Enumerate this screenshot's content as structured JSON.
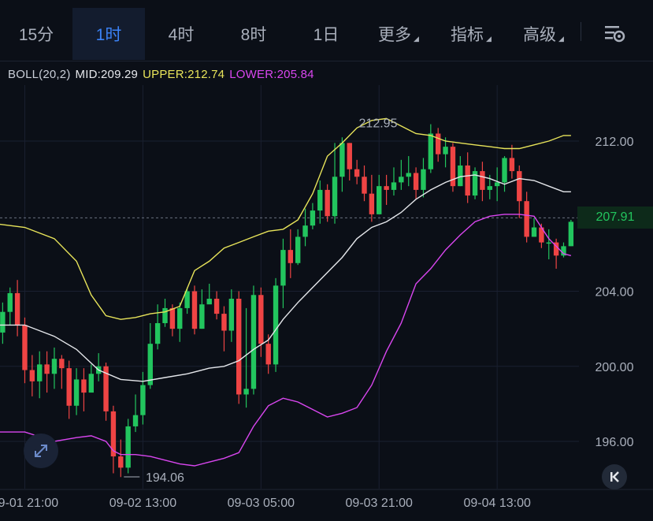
{
  "tabs": [
    {
      "label": "15分",
      "dropdown": false,
      "active": false
    },
    {
      "label": "1时",
      "dropdown": false,
      "active": true
    },
    {
      "label": "4时",
      "dropdown": false,
      "active": false
    },
    {
      "label": "8时",
      "dropdown": false,
      "active": false
    },
    {
      "label": "1日",
      "dropdown": false,
      "active": false
    },
    {
      "label": "更多",
      "dropdown": true,
      "active": false
    },
    {
      "label": "指标",
      "dropdown": true,
      "active": false
    },
    {
      "label": "高级",
      "dropdown": true,
      "active": false
    }
  ],
  "indicator": {
    "name": "BOLL(20,2)",
    "mid": "MID:209.29",
    "upper": "UPPER:212.74",
    "lower": "LOWER:205.84"
  },
  "current_price": "207.91",
  "colors": {
    "up": "#22c55e",
    "down": "#ef4444",
    "mid": "#e5e7eb",
    "upper": "#e8e45a",
    "lower": "#d946ef",
    "active_tab": "#3b82f6"
  },
  "icons": {
    "settings": "chart-settings-icon",
    "zoom": "expand-arrows-icon",
    "scroll": "jump-to-latest-icon"
  },
  "chart_data": {
    "type": "candlestick",
    "y_ticks": [
      "212.00",
      "204.00",
      "200.00",
      "196.00"
    ],
    "y_tick_values": [
      212,
      204,
      200,
      196
    ],
    "x_ticks": [
      "09-01 21:00",
      "09-02 13:00",
      "09-03 05:00",
      "09-03 21:00",
      "09-04 13:00"
    ],
    "x_tick_index": [
      4,
      20,
      36,
      52,
      68
    ],
    "annotations": [
      {
        "label": "212.95",
        "value": 212.95,
        "type": "high"
      },
      {
        "label": "194.06",
        "value": 194.06,
        "type": "low"
      }
    ],
    "current_value": 207.91,
    "y_range": [
      194.0,
      213.3
    ],
    "candles": [
      [
        204.6,
        203.2,
        204.0,
        201.8
      ],
      [
        201.8,
        202.9,
        203.4,
        201.2
      ],
      [
        202.9,
        203.9,
        204.2,
        202.2
      ],
      [
        203.9,
        202.2,
        204.6,
        201.6
      ],
      [
        202.2,
        199.8,
        202.6,
        199.1
      ],
      [
        199.8,
        199.2,
        200.6,
        198.4
      ],
      [
        199.2,
        200.1,
        200.8,
        198.3
      ],
      [
        200.1,
        199.6,
        200.8,
        198.6
      ],
      [
        199.6,
        200.4,
        201.0,
        198.8
      ],
      [
        200.4,
        199.9,
        200.6,
        198.8
      ],
      [
        199.9,
        197.9,
        200.3,
        197.2
      ],
      [
        197.9,
        199.3,
        199.9,
        197.4
      ],
      [
        199.3,
        198.6,
        199.9,
        197.6
      ],
      [
        198.6,
        199.6,
        200.1,
        198.9
      ],
      [
        199.6,
        200.0,
        200.7,
        199.2
      ],
      [
        200.0,
        197.6,
        200.2,
        197.1
      ],
      [
        197.6,
        195.2,
        197.9,
        194.3
      ],
      [
        195.2,
        194.6,
        196.1,
        194.1
      ],
      [
        194.6,
        196.8,
        197.2,
        194.3
      ],
      [
        196.8,
        197.4,
        198.5,
        196.5
      ],
      [
        197.4,
        199.0,
        199.7,
        196.9
      ],
      [
        199.0,
        201.2,
        202.3,
        198.8
      ],
      [
        201.2,
        202.3,
        203.3,
        200.9
      ],
      [
        202.3,
        203.1,
        203.6,
        202.1
      ],
      [
        203.1,
        202.0,
        203.3,
        201.6
      ],
      [
        202.0,
        203.1,
        203.4,
        201.3
      ],
      [
        203.1,
        204.0,
        204.2,
        202.8
      ],
      [
        204.0,
        202.0,
        204.3,
        201.7
      ],
      [
        202.0,
        203.3,
        204.1,
        202.0
      ],
      [
        203.3,
        203.6,
        204.4,
        203.4
      ],
      [
        203.6,
        202.8,
        204.0,
        202.5
      ],
      [
        202.8,
        201.9,
        203.2,
        200.8
      ],
      [
        201.9,
        203.6,
        204.1,
        201.3
      ],
      [
        203.6,
        198.5,
        204.0,
        198.0
      ],
      [
        198.5,
        198.8,
        203.1,
        197.8
      ],
      [
        198.8,
        203.8,
        204.3,
        198.5
      ],
      [
        203.8,
        201.2,
        204.2,
        200.5
      ],
      [
        201.2,
        200.1,
        201.7,
        199.6
      ],
      [
        200.1,
        204.3,
        204.7,
        199.7
      ],
      [
        204.3,
        206.2,
        206.8,
        203.1
      ],
      [
        206.2,
        205.5,
        207.3,
        204.7
      ],
      [
        205.5,
        206.9,
        207.3,
        205.4
      ],
      [
        206.9,
        207.5,
        208.4,
        206.4
      ],
      [
        207.5,
        208.3,
        208.7,
        207.3
      ],
      [
        208.3,
        209.4,
        209.9,
        207.6
      ],
      [
        209.4,
        208.0,
        209.7,
        207.7
      ],
      [
        208.0,
        210.1,
        211.9,
        207.6
      ],
      [
        210.1,
        211.9,
        212.2,
        209.3
      ],
      [
        211.9,
        210.5,
        211.9,
        209.9
      ],
      [
        210.5,
        210.1,
        211.0,
        209.7
      ],
      [
        210.1,
        209.2,
        210.7,
        208.8
      ],
      [
        209.2,
        208.1,
        210.2,
        207.7
      ],
      [
        208.1,
        209.6,
        210.2,
        208.1
      ],
      [
        209.6,
        209.4,
        210.2,
        208.6
      ],
      [
        209.4,
        209.8,
        210.6,
        209.1
      ],
      [
        209.8,
        210.1,
        211.0,
        209.4
      ],
      [
        210.1,
        210.3,
        211.2,
        209.6
      ],
      [
        210.3,
        209.4,
        210.6,
        208.9
      ],
      [
        209.4,
        210.5,
        211.1,
        209.0
      ],
      [
        210.5,
        212.4,
        212.9,
        210.3
      ],
      [
        212.4,
        211.3,
        212.7,
        210.9
      ],
      [
        211.3,
        211.7,
        212.2,
        210.6
      ],
      [
        211.7,
        209.6,
        211.9,
        209.3
      ],
      [
        209.6,
        210.7,
        211.2,
        209.6
      ],
      [
        210.7,
        209.1,
        211.4,
        208.7
      ],
      [
        209.1,
        210.4,
        210.6,
        208.9
      ],
      [
        210.4,
        209.4,
        210.9,
        208.8
      ],
      [
        209.4,
        209.6,
        210.2,
        208.9
      ],
      [
        209.6,
        209.8,
        210.6,
        208.8
      ],
      [
        209.8,
        211.1,
        211.2,
        209.3
      ],
      [
        211.1,
        210.4,
        211.8,
        210.0
      ],
      [
        210.4,
        208.8,
        210.7,
        207.9
      ],
      [
        208.8,
        206.9,
        209.3,
        206.6
      ],
      [
        206.9,
        207.4,
        207.9,
        206.9
      ],
      [
        207.4,
        206.6,
        207.6,
        206.3
      ],
      [
        206.6,
        206.6,
        207.3,
        205.7
      ],
      [
        206.6,
        205.9,
        206.8,
        205.2
      ],
      [
        205.9,
        206.4,
        206.6,
        205.8
      ],
      [
        206.4,
        207.7,
        207.8,
        206.4
      ]
    ],
    "series": [
      {
        "name": "UPPER",
        "points": [
          [
            0,
            207.6
          ],
          [
            4,
            207.4
          ],
          [
            8,
            206.8
          ],
          [
            11,
            205.6
          ],
          [
            13,
            203.8
          ],
          [
            15,
            202.7
          ],
          [
            17,
            202.5
          ],
          [
            19,
            202.6
          ],
          [
            21,
            202.8
          ],
          [
            23,
            202.9
          ],
          [
            25,
            203.2
          ],
          [
            27,
            205.1
          ],
          [
            29,
            205.6
          ],
          [
            31,
            206.3
          ],
          [
            33,
            206.6
          ],
          [
            35,
            206.9
          ],
          [
            37,
            207.2
          ],
          [
            39,
            207.3
          ],
          [
            41,
            207.8
          ],
          [
            43,
            209.2
          ],
          [
            45,
            211.2
          ],
          [
            47,
            211.9
          ],
          [
            49,
            212.7
          ],
          [
            51,
            213.1
          ],
          [
            53,
            213.2
          ],
          [
            55,
            212.8
          ],
          [
            57,
            212.4
          ],
          [
            59,
            212.3
          ],
          [
            61,
            212.0
          ],
          [
            63,
            211.9
          ],
          [
            65,
            211.8
          ],
          [
            67,
            211.7
          ],
          [
            69,
            211.6
          ],
          [
            71,
            211.6
          ],
          [
            73,
            211.8
          ],
          [
            75,
            212.0
          ],
          [
            77,
            212.3
          ],
          [
            78,
            212.3
          ]
        ]
      },
      {
        "name": "MID",
        "points": [
          [
            0,
            202.2
          ],
          [
            4,
            202.2
          ],
          [
            8,
            201.6
          ],
          [
            11,
            200.9
          ],
          [
            14,
            199.8
          ],
          [
            17,
            199.3
          ],
          [
            20,
            199.2
          ],
          [
            23,
            199.4
          ],
          [
            26,
            199.6
          ],
          [
            29,
            199.9
          ],
          [
            31,
            200.0
          ],
          [
            33,
            200.3
          ],
          [
            35,
            200.9
          ],
          [
            37,
            201.4
          ],
          [
            39,
            202.5
          ],
          [
            41,
            203.4
          ],
          [
            43,
            204.2
          ],
          [
            45,
            205.0
          ],
          [
            47,
            205.8
          ],
          [
            49,
            206.8
          ],
          [
            51,
            207.4
          ],
          [
            53,
            207.7
          ],
          [
            55,
            208.2
          ],
          [
            57,
            208.9
          ],
          [
            59,
            209.4
          ],
          [
            61,
            209.8
          ],
          [
            63,
            210.1
          ],
          [
            65,
            210.2
          ],
          [
            67,
            210.0
          ],
          [
            69,
            209.7
          ],
          [
            71,
            210.0
          ],
          [
            73,
            209.9
          ],
          [
            75,
            209.6
          ],
          [
            77,
            209.3
          ],
          [
            78,
            209.3
          ]
        ]
      },
      {
        "name": "LOWER",
        "points": [
          [
            0,
            196.5
          ],
          [
            4,
            196.5
          ],
          [
            8,
            196.0
          ],
          [
            11,
            196.2
          ],
          [
            13,
            196.3
          ],
          [
            15,
            196.0
          ],
          [
            16,
            195.5
          ],
          [
            17,
            195.3
          ],
          [
            19,
            195.3
          ],
          [
            21,
            195.2
          ],
          [
            23,
            195.0
          ],
          [
            25,
            194.8
          ],
          [
            27,
            194.7
          ],
          [
            29,
            194.9
          ],
          [
            31,
            195.1
          ],
          [
            33,
            195.4
          ],
          [
            35,
            196.8
          ],
          [
            37,
            197.9
          ],
          [
            39,
            198.3
          ],
          [
            41,
            198.1
          ],
          [
            43,
            197.7
          ],
          [
            45,
            197.3
          ],
          [
            47,
            197.5
          ],
          [
            49,
            197.8
          ],
          [
            51,
            199.0
          ],
          [
            53,
            200.8
          ],
          [
            55,
            202.3
          ],
          [
            57,
            204.4
          ],
          [
            59,
            205.2
          ],
          [
            61,
            206.2
          ],
          [
            63,
            207.0
          ],
          [
            65,
            207.7
          ],
          [
            67,
            208.0
          ],
          [
            69,
            208.1
          ],
          [
            71,
            208.1
          ],
          [
            73,
            208.0
          ],
          [
            75,
            206.8
          ],
          [
            77,
            206.0
          ],
          [
            78,
            205.9
          ]
        ]
      }
    ]
  }
}
